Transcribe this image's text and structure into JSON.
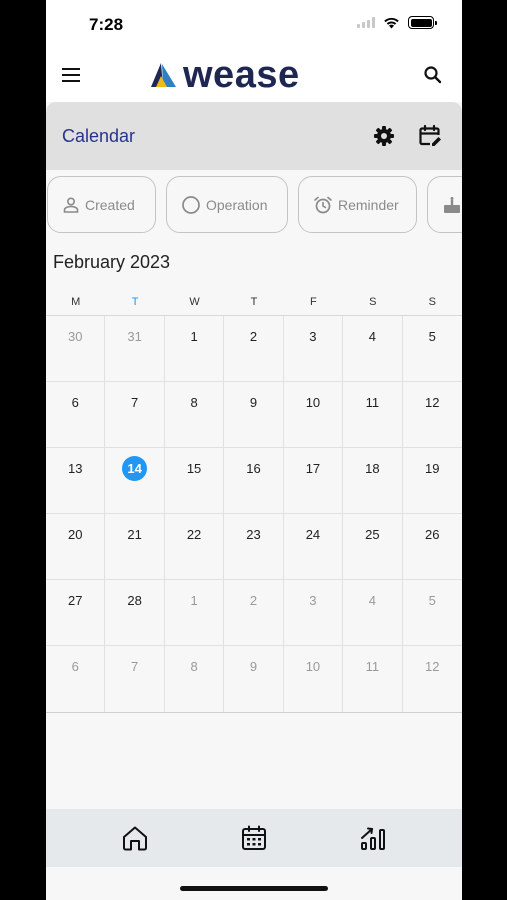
{
  "status_bar": {
    "time": "7:28"
  },
  "app": {
    "brand": "wease"
  },
  "header": {
    "title": "Calendar"
  },
  "filters": [
    {
      "label": "Created",
      "icon": "person-icon"
    },
    {
      "label": "Operation",
      "icon": "circle-icon"
    },
    {
      "label": "Reminder",
      "icon": "alarm-icon"
    },
    {
      "label": "",
      "icon": "cake-icon"
    }
  ],
  "calendar": {
    "month_label": "February 2023",
    "weekdays": [
      "M",
      "T",
      "W",
      "T",
      "F",
      "S",
      "S"
    ],
    "today_weekday_index": 1,
    "weeks": [
      [
        {
          "d": "30",
          "o": true
        },
        {
          "d": "31",
          "o": true
        },
        {
          "d": "1"
        },
        {
          "d": "2"
        },
        {
          "d": "3"
        },
        {
          "d": "4"
        },
        {
          "d": "5"
        }
      ],
      [
        {
          "d": "6"
        },
        {
          "d": "7"
        },
        {
          "d": "8"
        },
        {
          "d": "9"
        },
        {
          "d": "10"
        },
        {
          "d": "11"
        },
        {
          "d": "12"
        }
      ],
      [
        {
          "d": "13"
        },
        {
          "d": "14",
          "today": true
        },
        {
          "d": "15"
        },
        {
          "d": "16"
        },
        {
          "d": "17"
        },
        {
          "d": "18"
        },
        {
          "d": "19"
        }
      ],
      [
        {
          "d": "20"
        },
        {
          "d": "21"
        },
        {
          "d": "22"
        },
        {
          "d": "23"
        },
        {
          "d": "24"
        },
        {
          "d": "25"
        },
        {
          "d": "26"
        }
      ],
      [
        {
          "d": "27"
        },
        {
          "d": "28"
        },
        {
          "d": "1",
          "o": true
        },
        {
          "d": "2",
          "o": true
        },
        {
          "d": "3",
          "o": true
        },
        {
          "d": "4",
          "o": true
        },
        {
          "d": "5",
          "o": true
        }
      ],
      [
        {
          "d": "6",
          "o": true
        },
        {
          "d": "7",
          "o": true
        },
        {
          "d": "8",
          "o": true
        },
        {
          "d": "9",
          "o": true
        },
        {
          "d": "10",
          "o": true
        },
        {
          "d": "11",
          "o": true
        },
        {
          "d": "12",
          "o": true
        }
      ]
    ]
  },
  "bottom_nav": [
    {
      "name": "home",
      "icon": "home-icon"
    },
    {
      "name": "calendar",
      "icon": "calendar-icon"
    },
    {
      "name": "stats",
      "icon": "chart-icon"
    }
  ],
  "colors": {
    "accent": "#2196f3",
    "brand": "#1d2752",
    "title": "#27348b"
  }
}
